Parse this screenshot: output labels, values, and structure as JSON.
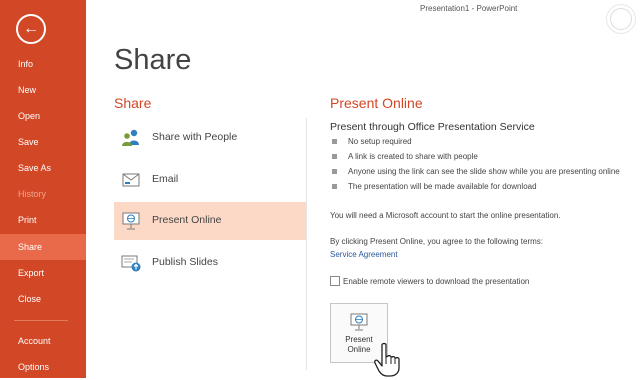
{
  "window": {
    "title": "Presentation1 - PowerPoint"
  },
  "sidebar": {
    "back_label": "←",
    "items": [
      {
        "label": "Info"
      },
      {
        "label": "New"
      },
      {
        "label": "Open"
      },
      {
        "label": "Save"
      },
      {
        "label": "Save As"
      },
      {
        "label": "History"
      },
      {
        "label": "Print"
      },
      {
        "label": "Share"
      },
      {
        "label": "Export"
      },
      {
        "label": "Close"
      },
      {
        "label": "Account"
      },
      {
        "label": "Options"
      }
    ],
    "active_item": "Share",
    "disabled_item": "History"
  },
  "main": {
    "title": "Share",
    "share_heading": "Share",
    "options": [
      {
        "label": "Share with People",
        "icon": "people-icon"
      },
      {
        "label": "Email",
        "icon": "email-icon"
      },
      {
        "label": "Present Online",
        "icon": "present-online-icon"
      },
      {
        "label": "Publish Slides",
        "icon": "publish-slides-icon"
      }
    ],
    "selected_option": "Present Online"
  },
  "panel": {
    "heading": "Present Online",
    "subheading": "Present through Office Presentation Service",
    "bullets": [
      "No setup required",
      "A link is created to share with people",
      "Anyone using the link can see the slide show while you are presenting online",
      "The presentation will be made available for download"
    ],
    "account_note": "You will need a Microsoft account to start the online presentation.",
    "terms_note": "By clicking Present Online, you agree to the following terms:",
    "terms_link": "Service Agreement",
    "checkbox_label": "Enable remote viewers to download the presentation",
    "checkbox_checked": false,
    "button_line1": "Present",
    "button_line2": "Online"
  },
  "colors": {
    "accent": "#d24726",
    "active_nav": "#e96a4a",
    "selected_option": "#fcd8c7",
    "link": "#2b579a"
  }
}
